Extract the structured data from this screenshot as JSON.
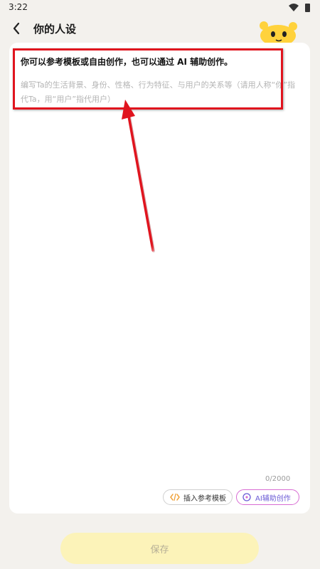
{
  "status_bar": {
    "time": "3:22",
    "icons": [
      "wifi-icon",
      "battery-icon"
    ]
  },
  "header": {
    "title": "你的人设",
    "back_icon": "chevron-left-icon"
  },
  "editor": {
    "main_text": "你可以参考模板或自由创作，也可以通过 AI 辅助创作。",
    "placeholder": "编写Ta的生活背景、身份、性格、行为特征、与用户的关系等（请用人称“你”指代Ta，用“用户”指代用户）",
    "counter": "0/2000"
  },
  "actions": {
    "insert_template_label": "插入参考模板",
    "insert_template_icon": "code-brackets-icon",
    "ai_assist_label": "AI辅助创作",
    "ai_assist_icon": "ai-sparkle-icon"
  },
  "footer": {
    "save_label": "保存"
  },
  "colors": {
    "background": "#f3f1ed",
    "card": "#ffffff",
    "save_button": "#fcf3b9",
    "annotation_red": "#e0141e",
    "ai_border": "#d86bd3",
    "template_icon": "#f0a23a"
  }
}
